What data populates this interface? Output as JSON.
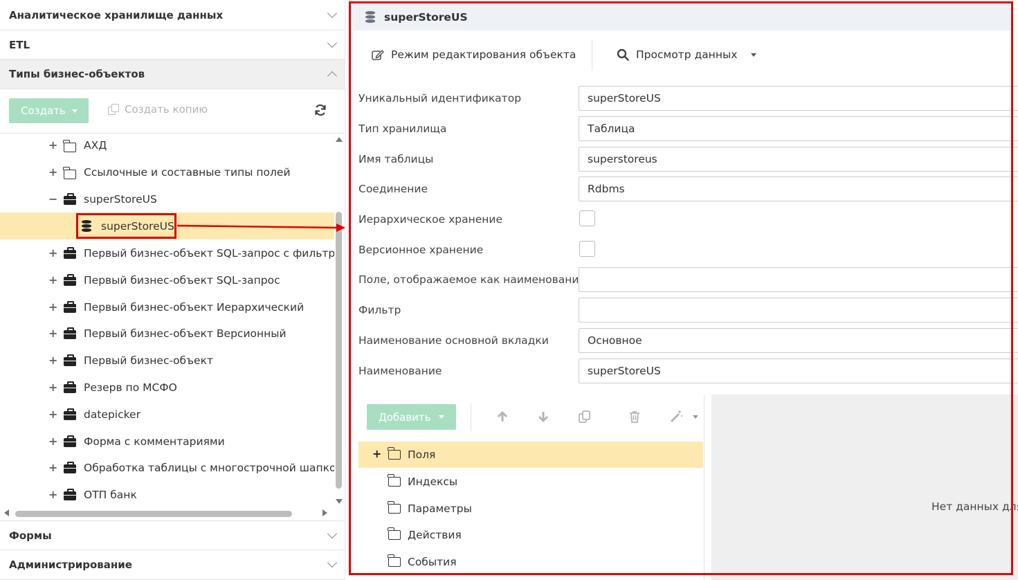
{
  "left_panel": {
    "accordion": [
      {
        "label": "Аналитическое хранилище данных",
        "expanded": false
      },
      {
        "label": "ETL",
        "expanded": false
      },
      {
        "label": "Типы бизнес-объектов",
        "expanded": true
      },
      {
        "label": "Формы",
        "expanded": false
      },
      {
        "label": "Администрирование",
        "expanded": false
      }
    ],
    "toolbar": {
      "create_label": "Создать",
      "copy_label": "Создать копию",
      "refresh_icon": "refresh-icon"
    },
    "tree": [
      {
        "label": "АХД",
        "icon": "folder-icon",
        "toggle": "+"
      },
      {
        "label": "Ссылочные и составные типы полей",
        "icon": "folder-icon",
        "toggle": "+"
      },
      {
        "label": "superStoreUS",
        "icon": "briefcase-icon",
        "toggle": "−"
      },
      {
        "label": "superStoreUS",
        "icon": "database-icon",
        "toggle": "",
        "selected": true
      },
      {
        "label": "Первый бизнес-объект SQL-запрос с фильтраци",
        "icon": "briefcase-icon",
        "toggle": "+"
      },
      {
        "label": "Первый бизнес-объект SQL-запрос",
        "icon": "briefcase-icon",
        "toggle": "+"
      },
      {
        "label": "Первый бизнес-объект Иерархический",
        "icon": "briefcase-icon",
        "toggle": "+"
      },
      {
        "label": "Первый бизнес-объект Версионный",
        "icon": "briefcase-icon",
        "toggle": "+"
      },
      {
        "label": "Первый бизнес-объект",
        "icon": "briefcase-icon",
        "toggle": "+"
      },
      {
        "label": "Резерв по МСФО",
        "icon": "briefcase-icon",
        "toggle": "+"
      },
      {
        "label": "datepicker",
        "icon": "briefcase-icon",
        "toggle": "+"
      },
      {
        "label": "Форма с комментариями",
        "icon": "briefcase-icon",
        "toggle": "+"
      },
      {
        "label": "Обработка таблицы с многострочной шапкой",
        "icon": "briefcase-icon",
        "toggle": "+"
      },
      {
        "label": "ОТП банк",
        "icon": "briefcase-icon",
        "toggle": "+"
      }
    ]
  },
  "right_panel": {
    "title": "superStoreUS",
    "toolbar": {
      "edit_mode_label": "Режим редактирования объекта",
      "view_data_label": "Просмотр данных"
    },
    "fields": [
      {
        "label": "Уникальный идентификатор",
        "type": "text",
        "value": "superStoreUS"
      },
      {
        "label": "Тип хранилища",
        "type": "text",
        "value": "Таблица"
      },
      {
        "label": "Имя таблицы",
        "type": "text",
        "value": "superstoreus"
      },
      {
        "label": "Соединение",
        "type": "text",
        "value": "Rdbms"
      },
      {
        "label": "Иерархическое хранение",
        "type": "checkbox",
        "checked": false
      },
      {
        "label": "Версионное хранение",
        "type": "checkbox",
        "checked": false
      },
      {
        "label": "Поле, отображаемое как наименование",
        "type": "text",
        "value": ""
      },
      {
        "label": "Фильтр",
        "type": "text",
        "value": ""
      },
      {
        "label": "Наименование основной вкладки",
        "type": "text",
        "value": "Основное"
      },
      {
        "label": "Наименование",
        "type": "text",
        "value": "superStoreUS"
      }
    ],
    "bottom_toolbar": {
      "add_label": "Добавить",
      "icons": [
        "arrow-up-icon",
        "arrow-down-icon",
        "copy-icon",
        "trash-icon",
        "wand-icon"
      ]
    },
    "bottom_tree": [
      {
        "label": "Поля",
        "toggle": "+",
        "selected": true
      },
      {
        "label": "Индексы",
        "toggle": ""
      },
      {
        "label": "Параметры",
        "toggle": ""
      },
      {
        "label": "Действия",
        "toggle": ""
      },
      {
        "label": "События",
        "toggle": ""
      }
    ],
    "no_data_text": "Нет данных для"
  },
  "colors": {
    "accent_green_disabled": "#a8dfc2",
    "selection": "#fde9b0",
    "annotation_red": "#e10000"
  }
}
